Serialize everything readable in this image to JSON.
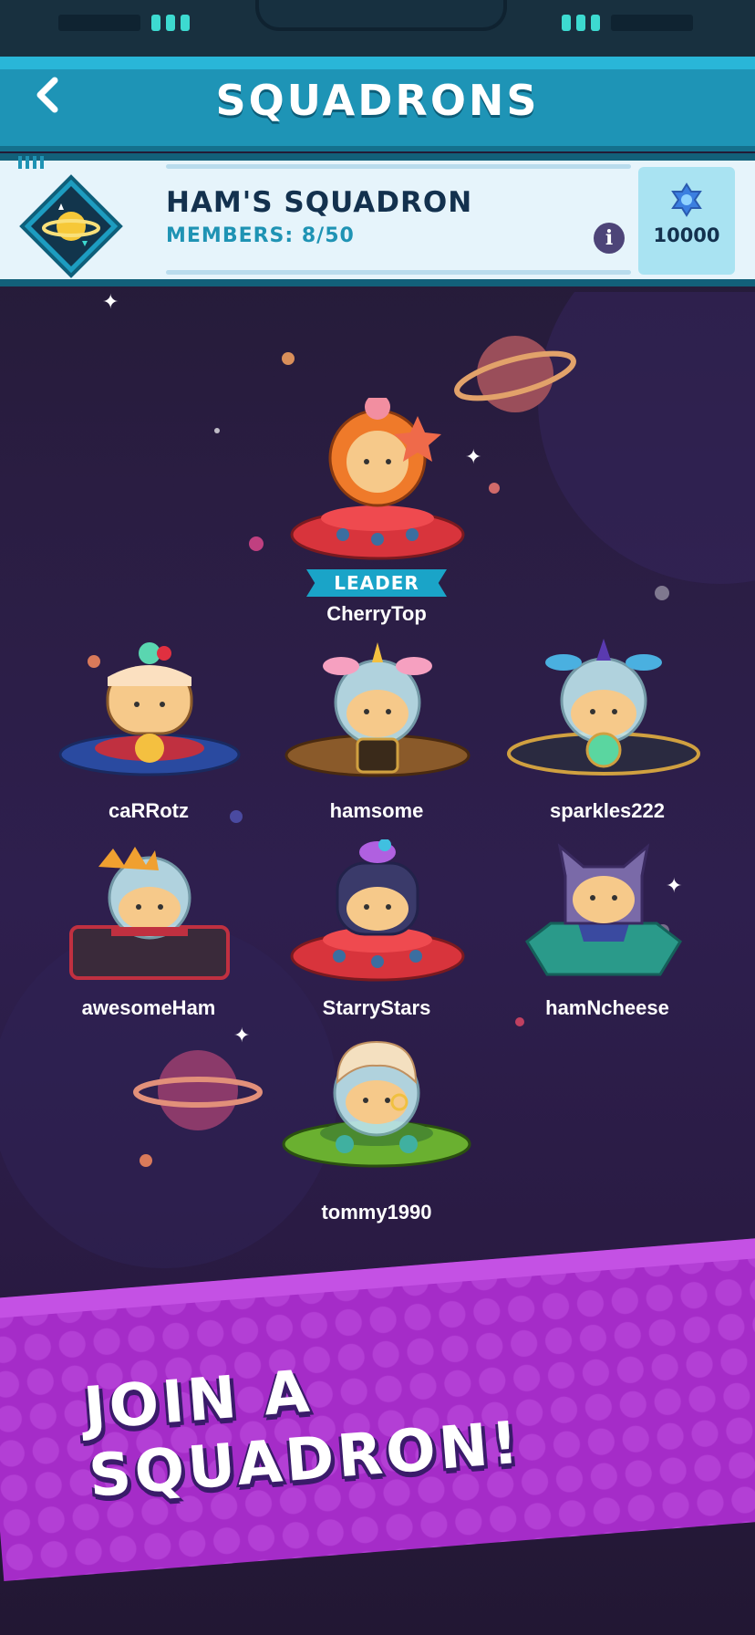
{
  "header": {
    "title": "SQUADRONS",
    "back_label": "<"
  },
  "squad": {
    "name": "HAM'S SQUADRON",
    "members_label": "MEMBERS: 8/50",
    "info_label": "i",
    "gems": "10000"
  },
  "leader_badge": "LEADER",
  "members": [
    {
      "name": "CherryTop"
    },
    {
      "name": "caRRotz"
    },
    {
      "name": "hamsome"
    },
    {
      "name": "sparkles222"
    },
    {
      "name": "awesomeHam"
    },
    {
      "name": "StarryStars"
    },
    {
      "name": "hamNcheese"
    },
    {
      "name": "tommy1990"
    }
  ],
  "banner": {
    "label": "JOIN A SQUADRON!"
  },
  "colors": {
    "accent": "#1e94b6",
    "banner": "#a52cc8",
    "background": "#2a1d42"
  }
}
